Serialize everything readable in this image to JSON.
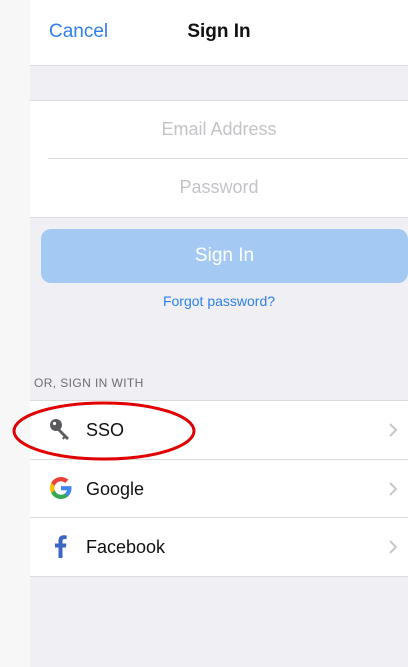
{
  "nav": {
    "cancel_label": "Cancel",
    "title": "Sign In"
  },
  "form": {
    "email_placeholder": "Email Address",
    "password_placeholder": "Password"
  },
  "actions": {
    "sign_in_label": "Sign In",
    "forgot_label": "Forgot password?"
  },
  "providers": {
    "header": "OR, SIGN IN WITH",
    "items": [
      {
        "label": "SSO",
        "icon": "key-icon"
      },
      {
        "label": "Google",
        "icon": "google-icon"
      },
      {
        "label": "Facebook",
        "icon": "facebook-icon"
      }
    ]
  },
  "colors": {
    "accent": "#2f80ed",
    "button_disabled": "#a4c9f3",
    "highlight": "#e00000",
    "facebook": "#3b66c4"
  }
}
